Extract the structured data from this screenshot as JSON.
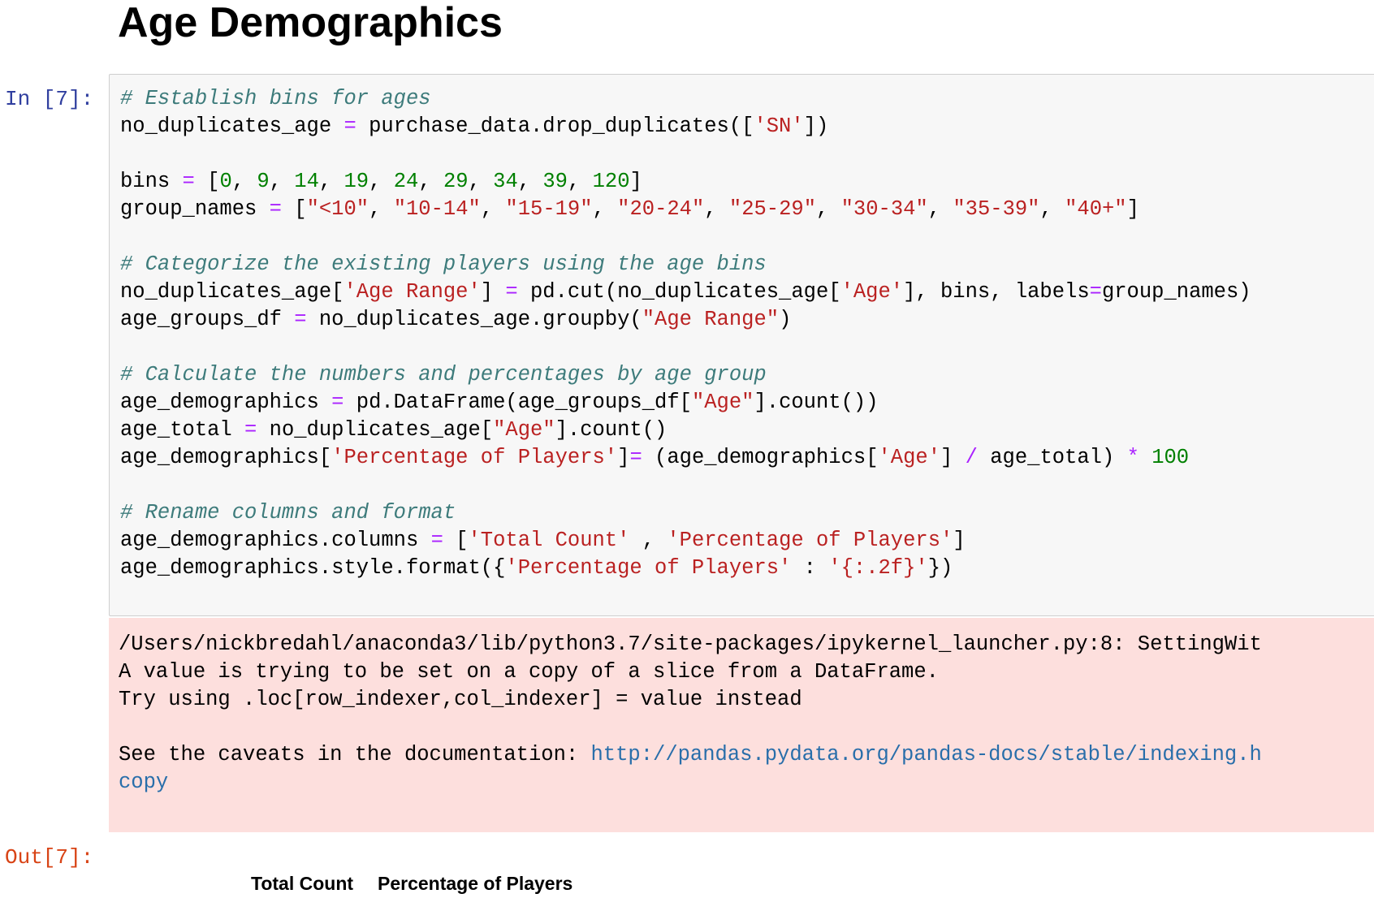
{
  "heading": "Age Demographics",
  "input_prompt": "In [7]:",
  "output_prompt": "Out[7]:",
  "code": {
    "comment_bins": "# Establish bins for ages",
    "no_dup_lhs": "no_duplicates_age ",
    "eq": "=",
    "no_dup_mid": " purchase_data.drop_duplicates([",
    "str_SN": "'SN'",
    "no_dup_end": "])",
    "bins_lhs": "bins ",
    "bins_open": " [",
    "num_0": "0",
    "num_9": "9",
    "num_14": "14",
    "num_19": "19",
    "num_24": "24",
    "num_29": "29",
    "num_34": "34",
    "num_39": "39",
    "num_120": "120",
    "sep": ", ",
    "close_bracket": "]",
    "group_lhs": "group_names ",
    "g1": "\"<10\"",
    "g2": "\"10-14\"",
    "g3": "\"15-19\"",
    "g4": "\"20-24\"",
    "g5": "\"25-29\"",
    "g6": "\"30-34\"",
    "g7": "\"35-39\"",
    "g8": "\"40+\"",
    "comment_categorize": "# Categorize the existing players using the age bins",
    "cut_a": "no_duplicates_age[",
    "str_age_range_sq": "'Age Range'",
    "cut_b": "] ",
    "cut_c": " pd.cut(no_duplicates_age[",
    "str_age_sq": "'Age'",
    "cut_d": "], bins, labels",
    "cut_e": "group_names)",
    "groups_lhs": "age_groups_df ",
    "groups_mid": " no_duplicates_age.groupby(",
    "str_age_range_dq": "\"Age Range\"",
    "close_paren": ")",
    "comment_calc": "# Calculate the numbers and percentages by age group",
    "demo_lhs": "age_demographics ",
    "demo_mid": " pd.DataFrame(age_groups_df[",
    "str_age_dq": "\"Age\"",
    "demo_end": "].count())",
    "total_lhs": "age_total ",
    "total_mid": " no_duplicates_age[",
    "total_end": "].count()",
    "pct_a": "age_demographics[",
    "str_pct_sq": "'Percentage of Players'",
    "pct_b": "]",
    "pct_c": " (age_demographics[",
    "pct_d": "] ",
    "div": "/",
    "pct_e": " age_total) ",
    "mul": "*",
    "num_100": "100",
    "comment_rename": "# Rename columns and format",
    "cols_lhs": "age_demographics.columns ",
    "str_total_count": "'Total Count'",
    "cols_mid": " , ",
    "fmt_a": "age_demographics.style.format({",
    "fmt_b": " : ",
    "str_fmt": "'{:.2f}'",
    "fmt_c": "})"
  },
  "stderr": {
    "line1": "/Users/nickbredahl/anaconda3/lib/python3.7/site-packages/ipykernel_launcher.py:8: SettingWit",
    "line2": "A value is trying to be set on a copy of a slice from a DataFrame.",
    "line3": "Try using .loc[row_indexer,col_indexer] = value instead",
    "line5_text": "See the caveats in the documentation: ",
    "line5_link": "http://pandas.pydata.org/pandas-docs/stable/indexing.h",
    "line6_link": "copy"
  },
  "table": {
    "columns": [
      "Total Count",
      "Percentage of Players"
    ]
  }
}
